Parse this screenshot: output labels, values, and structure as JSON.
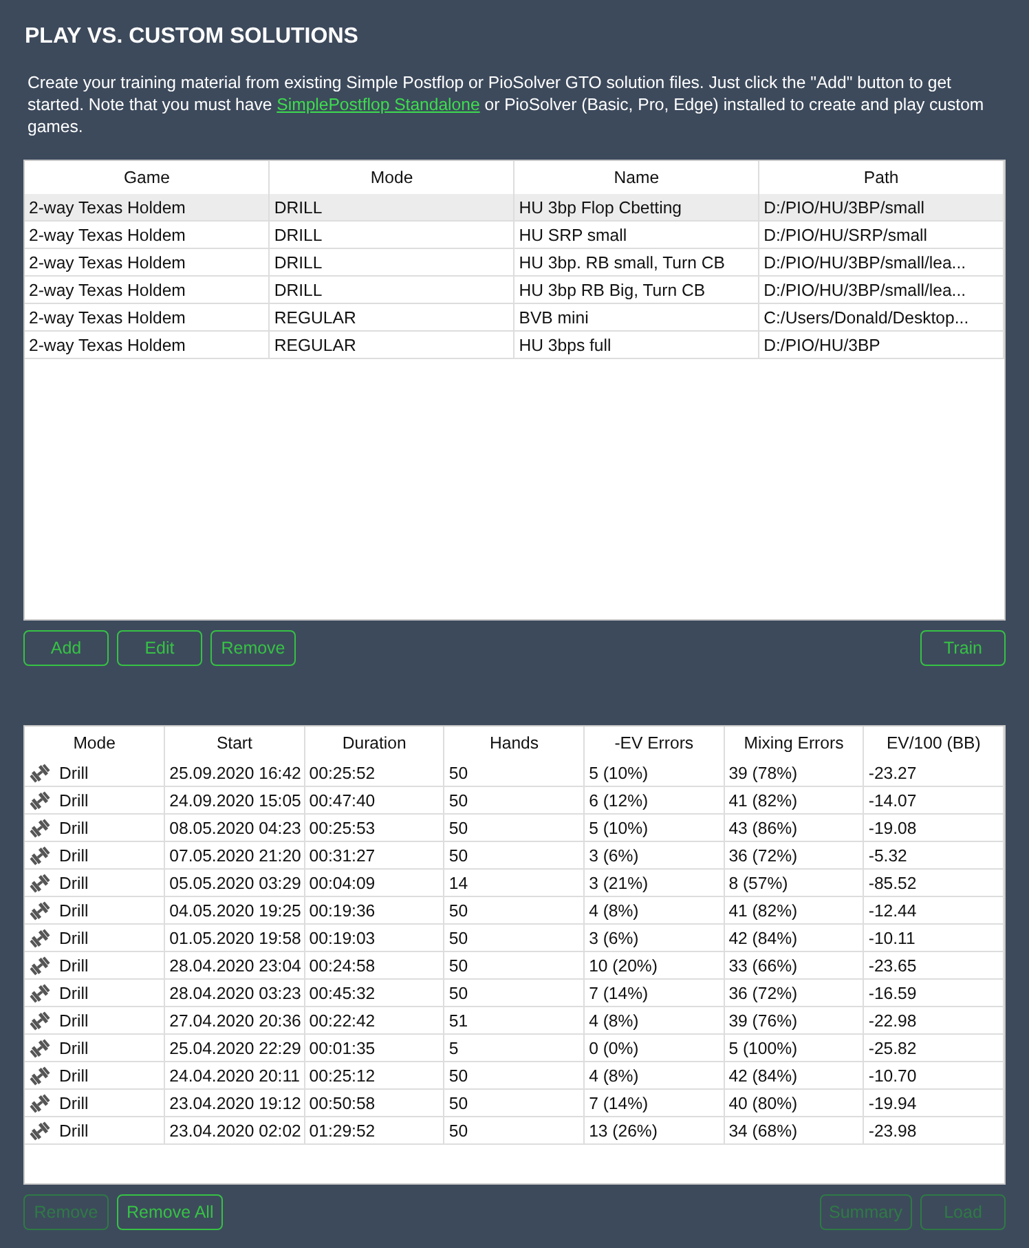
{
  "title": "PLAY VS. CUSTOM SOLUTIONS",
  "intro": {
    "before": "Create your training material from existing Simple Postflop or PioSolver GTO solution files. Just click the \"Add\" button to get started. Note that you must have ",
    "link": "SimplePostflop Standalone",
    "after": " or PioSolver (Basic, Pro, Edge) installed to create and play custom games."
  },
  "solutions": {
    "columns": [
      "Game",
      "Mode",
      "Name",
      "Path"
    ],
    "rows": [
      {
        "game": "2-way Texas Holdem",
        "mode": "DRILL",
        "name": "HU 3bp Flop Cbetting",
        "path": "D:/PIO/HU/3BP/small",
        "selected": true
      },
      {
        "game": "2-way Texas Holdem",
        "mode": "DRILL",
        "name": "HU SRP small",
        "path": "D:/PIO/HU/SRP/small",
        "selected": false
      },
      {
        "game": "2-way Texas Holdem",
        "mode": "DRILL",
        "name": "HU 3bp. RB small, Turn CB",
        "path": "D:/PIO/HU/3BP/small/lea...",
        "selected": false
      },
      {
        "game": "2-way Texas Holdem",
        "mode": "DRILL",
        "name": "HU 3bp RB Big, Turn CB",
        "path": "D:/PIO/HU/3BP/small/lea...",
        "selected": false
      },
      {
        "game": "2-way Texas Holdem",
        "mode": "REGULAR",
        "name": "BVB mini",
        "path": "C:/Users/Donald/Desktop...",
        "selected": false
      },
      {
        "game": "2-way Texas Holdem",
        "mode": "REGULAR",
        "name": "HU 3bps full",
        "path": "D:/PIO/HU/3BP",
        "selected": false
      }
    ]
  },
  "solution_buttons_left": [
    {
      "label": "Add",
      "disabled": false
    },
    {
      "label": "Edit",
      "disabled": false
    },
    {
      "label": "Remove",
      "disabled": false
    }
  ],
  "solution_buttons_right": [
    {
      "label": "Train",
      "disabled": false
    }
  ],
  "sessions": {
    "columns": [
      "Mode",
      "Start",
      "Duration",
      "Hands",
      "-EV Errors",
      "Mixing Errors",
      "EV/100 (BB)"
    ],
    "rows": [
      [
        "Drill",
        "25.09.2020 16:42",
        "00:25:52",
        "50",
        "5 (10%)",
        "39 (78%)",
        "-23.27"
      ],
      [
        "Drill",
        "24.09.2020 15:05",
        "00:47:40",
        "50",
        "6 (12%)",
        "41 (82%)",
        "-14.07"
      ],
      [
        "Drill",
        "08.05.2020 04:23",
        "00:25:53",
        "50",
        "5 (10%)",
        "43 (86%)",
        "-19.08"
      ],
      [
        "Drill",
        "07.05.2020 21:20",
        "00:31:27",
        "50",
        "3 (6%)",
        "36 (72%)",
        "-5.32"
      ],
      [
        "Drill",
        "05.05.2020 03:29",
        "00:04:09",
        "14",
        "3 (21%)",
        "8 (57%)",
        "-85.52"
      ],
      [
        "Drill",
        "04.05.2020 19:25",
        "00:19:36",
        "50",
        "4 (8%)",
        "41 (82%)",
        "-12.44"
      ],
      [
        "Drill",
        "01.05.2020 19:58",
        "00:19:03",
        "50",
        "3 (6%)",
        "42 (84%)",
        "-10.11"
      ],
      [
        "Drill",
        "28.04.2020 23:04",
        "00:24:58",
        "50",
        "10 (20%)",
        "33 (66%)",
        "-23.65"
      ],
      [
        "Drill",
        "28.04.2020 03:23",
        "00:45:32",
        "50",
        "7 (14%)",
        "36 (72%)",
        "-16.59"
      ],
      [
        "Drill",
        "27.04.2020 20:36",
        "00:22:42",
        "51",
        "4 (8%)",
        "39 (76%)",
        "-22.98"
      ],
      [
        "Drill",
        "25.04.2020 22:29",
        "00:01:35",
        "5",
        "0 (0%)",
        "5 (100%)",
        "-25.82"
      ],
      [
        "Drill",
        "24.04.2020 20:11",
        "00:25:12",
        "50",
        "4 (8%)",
        "42 (84%)",
        "-10.70"
      ],
      [
        "Drill",
        "23.04.2020 19:12",
        "00:50:58",
        "50",
        "7 (14%)",
        "40 (80%)",
        "-19.94"
      ],
      [
        "Drill",
        "23.04.2020 02:02",
        "01:29:52",
        "50",
        "13 (26%)",
        "34 (68%)",
        "-23.98"
      ]
    ]
  },
  "session_buttons_left": [
    {
      "label": "Remove",
      "disabled": true
    },
    {
      "label": "Remove All",
      "disabled": false
    }
  ],
  "session_buttons_right": [
    {
      "label": "Summary",
      "disabled": true
    },
    {
      "label": "Load",
      "disabled": true
    }
  ]
}
